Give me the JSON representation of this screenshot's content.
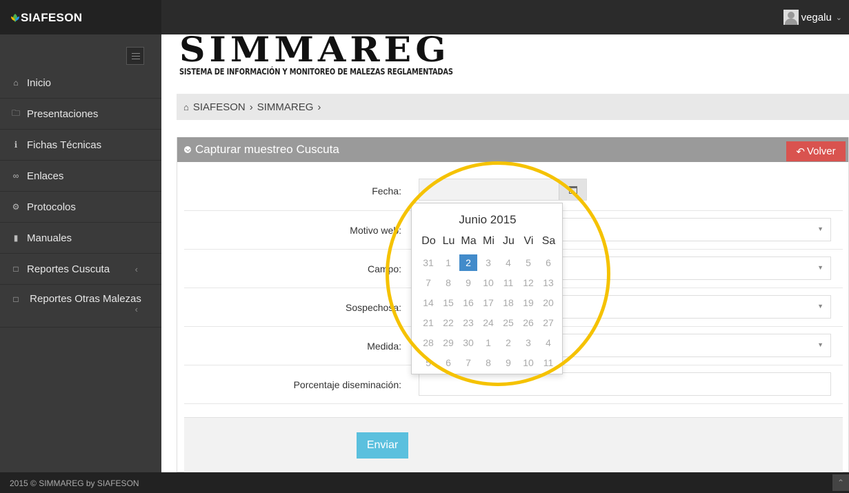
{
  "topbar": {
    "brand": "SIAFESON",
    "user": "vegalu"
  },
  "sidebar": {
    "items": [
      {
        "label": "Inicio",
        "icon": "home-icon"
      },
      {
        "label": "Presentaciones",
        "icon": "folder-icon"
      },
      {
        "label": "Fichas Técnicas",
        "icon": "info-icon"
      },
      {
        "label": "Enlaces",
        "icon": "link-icon"
      },
      {
        "label": "Protocolos",
        "icon": "gear-icon"
      },
      {
        "label": "Manuales",
        "icon": "book-icon"
      },
      {
        "label": "Reportes Cuscuta",
        "icon": "file-icon"
      },
      {
        "label": "Reportes Otras Malezas",
        "icon": "file-icon"
      }
    ]
  },
  "header": {
    "logo_title": "SIMMAREG",
    "logo_subtitle": "SISTEMA DE INFORMACIÓN Y MONITOREO DE MALEZAS REGLAMENTADAS"
  },
  "breadcrumb": {
    "items": [
      "SIAFESON",
      "SIMMAREG"
    ]
  },
  "panel": {
    "title": "Capturar muestreo Cuscuta",
    "back_label": "Volver",
    "fields": {
      "fecha": "Fecha:",
      "motivo": "Motivo web:",
      "campo": "Campo:",
      "sospechosa": "Sospechosa:",
      "medida": "Medida:",
      "porcentaje": "Porcentaje diseminación:"
    },
    "submit_label": "Enviar"
  },
  "datepicker": {
    "title": "Junio 2015",
    "weekdays": [
      "Do",
      "Lu",
      "Ma",
      "Mi",
      "Ju",
      "Vi",
      "Sa"
    ],
    "weeks": [
      [
        "31",
        "1",
        "2",
        "3",
        "4",
        "5",
        "6"
      ],
      [
        "7",
        "8",
        "9",
        "10",
        "11",
        "12",
        "13"
      ],
      [
        "14",
        "15",
        "16",
        "17",
        "18",
        "19",
        "20"
      ],
      [
        "21",
        "22",
        "23",
        "24",
        "25",
        "26",
        "27"
      ],
      [
        "28",
        "29",
        "30",
        "1",
        "2",
        "3",
        "4"
      ],
      [
        "5",
        "6",
        "7",
        "8",
        "9",
        "10",
        "11"
      ]
    ],
    "selected": "2"
  },
  "colors": {
    "highlight_ring": "#f5c200",
    "selected_day": "#428bca",
    "back_button": "#d9534f",
    "submit_button": "#5bc0de"
  },
  "footer": {
    "copyright": "2015 © SIMMAREG by SIAFESON"
  }
}
